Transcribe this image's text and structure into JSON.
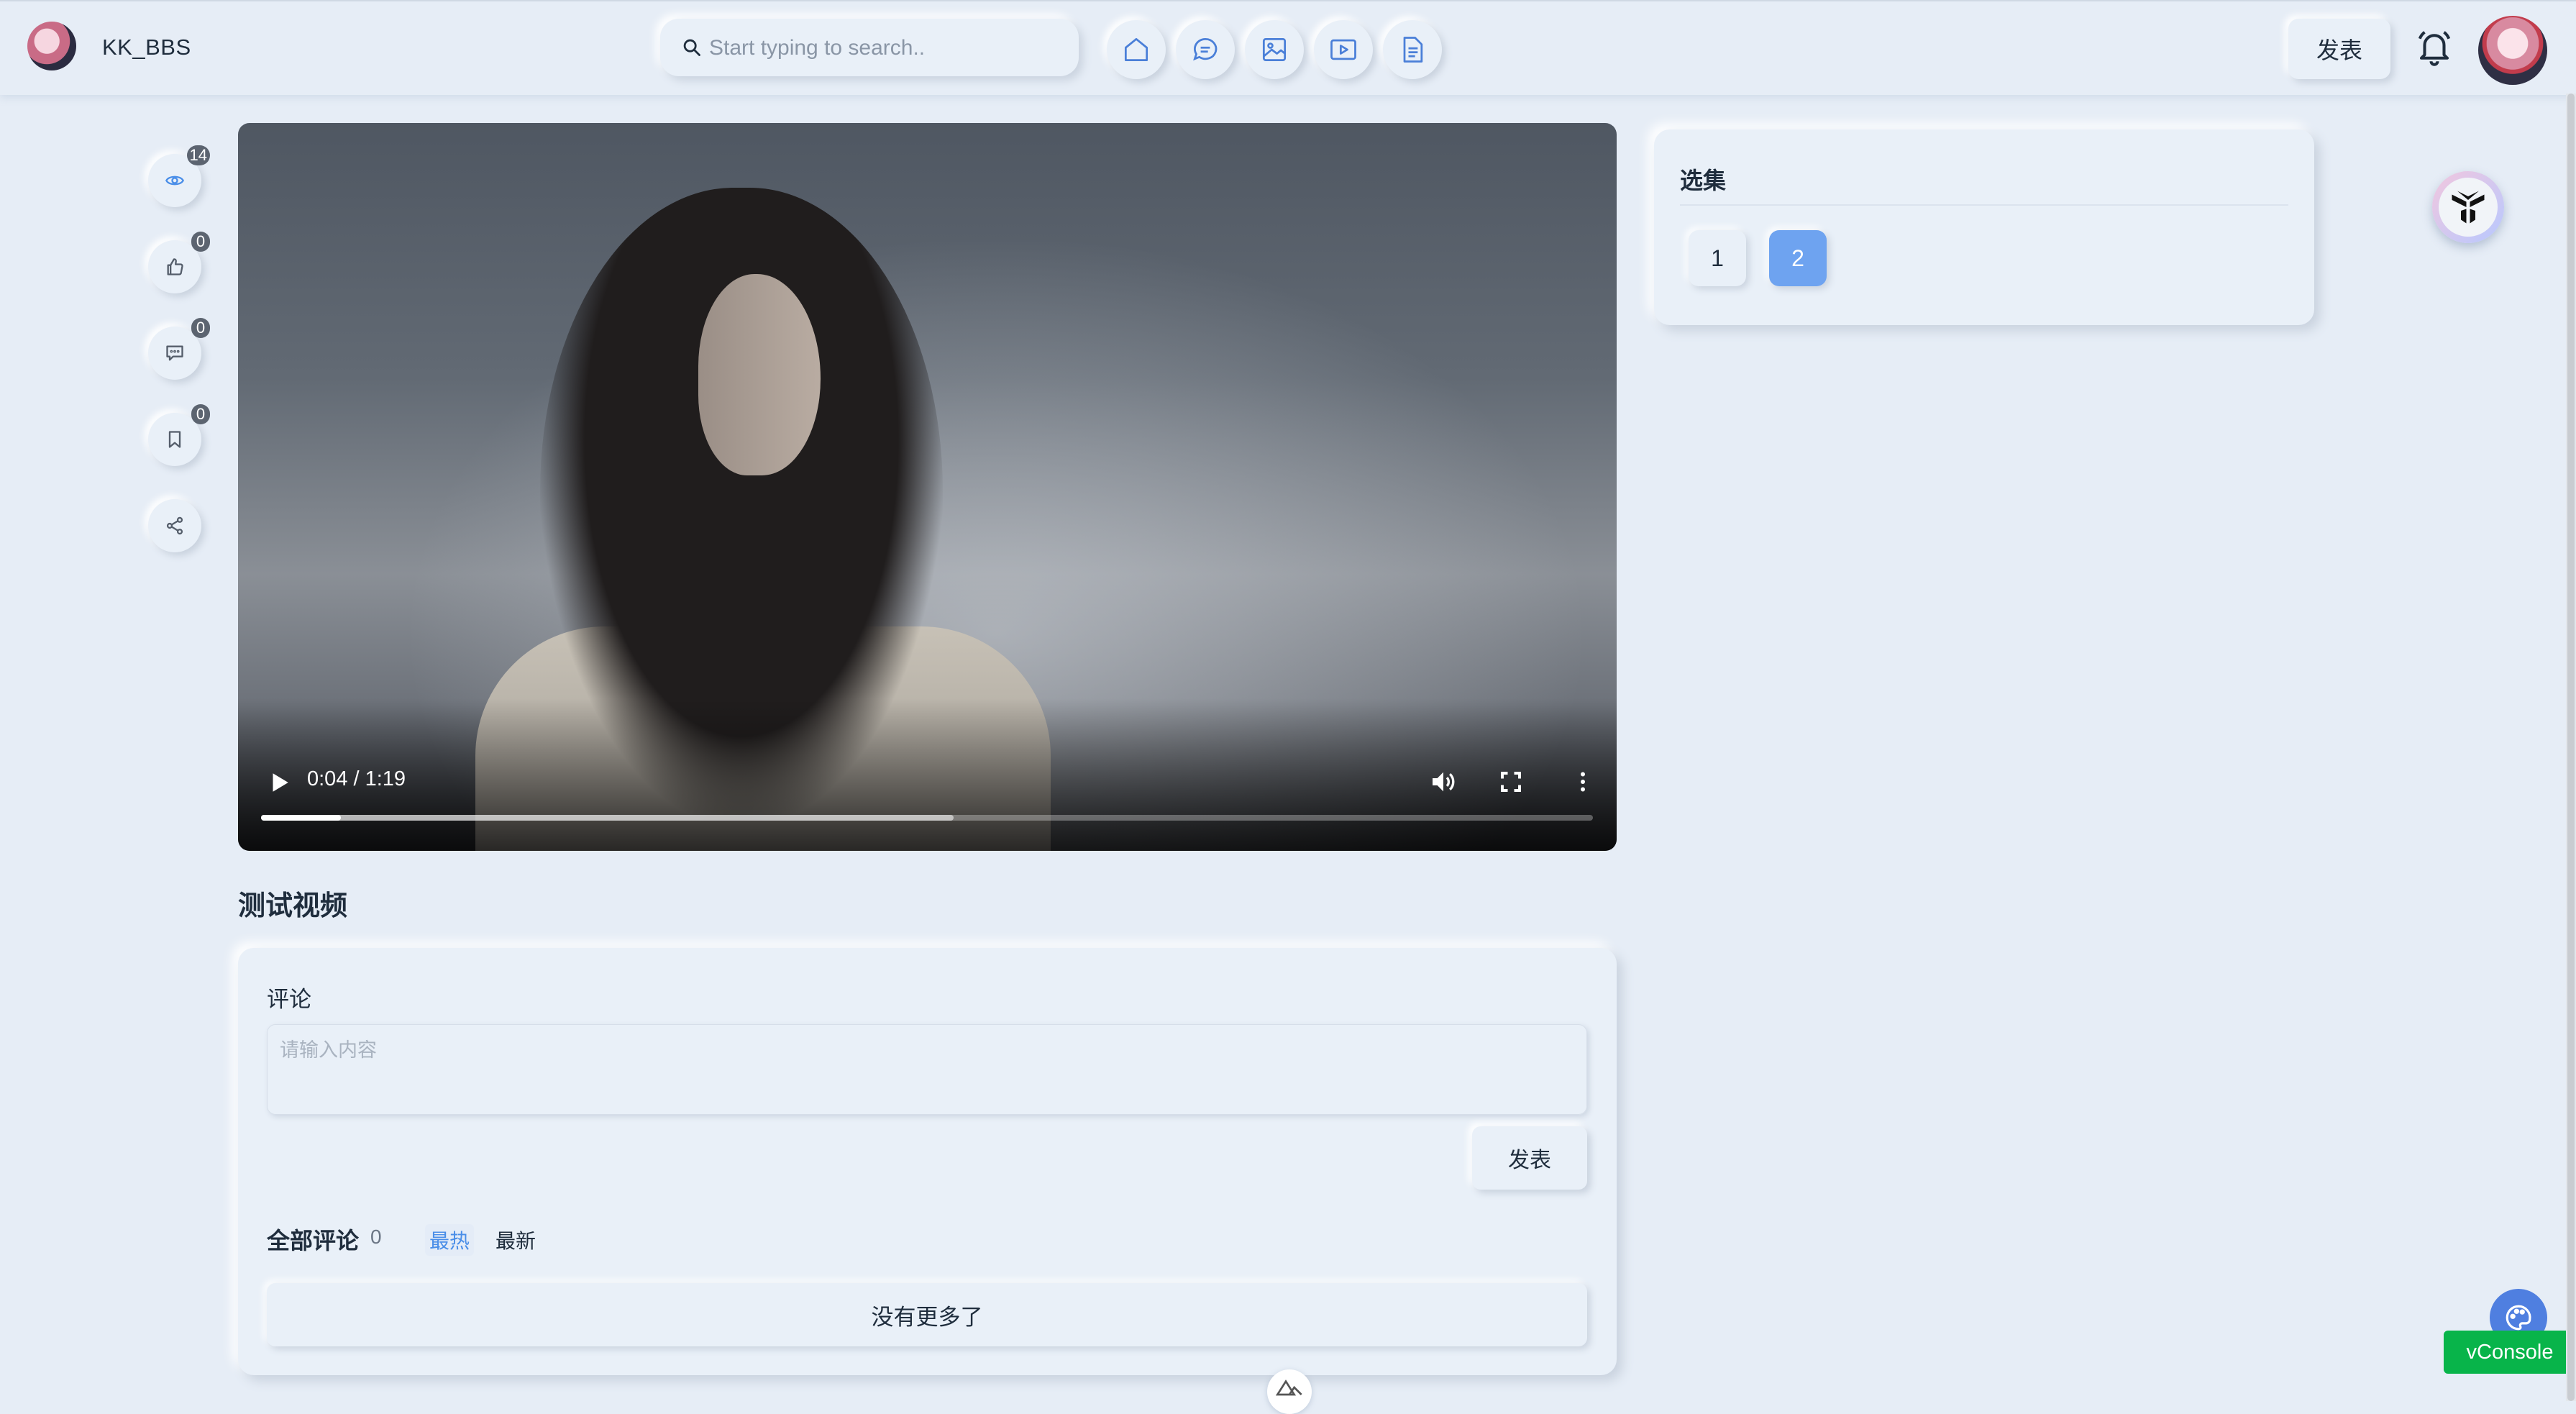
{
  "header": {
    "site_name": "KK_BBS",
    "search_placeholder": "Start typing to search..",
    "nav_icons": [
      "home-icon",
      "chat-icon",
      "image-icon",
      "video-icon",
      "document-icon"
    ],
    "post_label": "发表"
  },
  "actions": [
    {
      "icon": "eye-icon",
      "count": "14"
    },
    {
      "icon": "thumbs-up-icon",
      "count": "0"
    },
    {
      "icon": "comment-icon",
      "count": "0"
    },
    {
      "icon": "bookmark-icon",
      "count": "0"
    },
    {
      "icon": "share-icon",
      "count": null
    }
  ],
  "video": {
    "time": "0:04 / 1:19",
    "progress": 0.06,
    "buffered": 0.52
  },
  "video_title": "测试视频",
  "comments": {
    "label": "评论",
    "placeholder": "请输入内容",
    "submit_label": "发表",
    "all_label": "全部评论",
    "count": "0",
    "sort_hot": "最热",
    "sort_new": "最新",
    "no_more": "没有更多了"
  },
  "episodes": {
    "title": "选集",
    "items": [
      "1",
      "2"
    ],
    "selected": "2"
  },
  "floating": {
    "vconsole_label": "vConsole"
  },
  "colors": {
    "background": "#e6edf6",
    "accent": "#6ea3f0",
    "link": "#4a8ee8",
    "vconsole": "#08b44a"
  }
}
